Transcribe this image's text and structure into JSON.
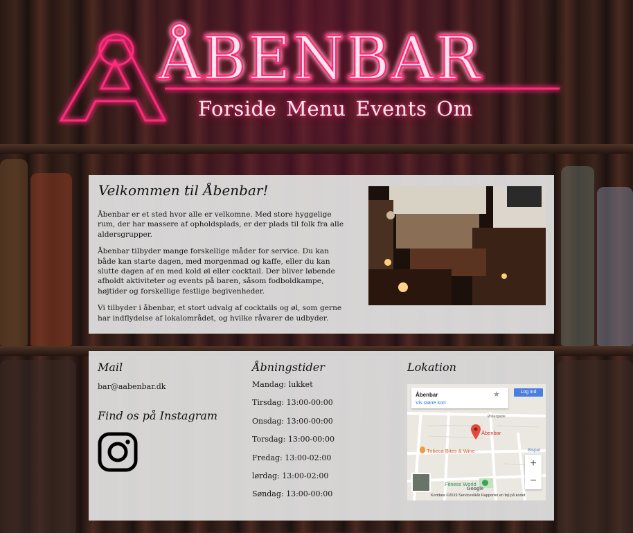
{
  "brand": {
    "name": "ÅBENBAR"
  },
  "nav": {
    "items": [
      "Forside",
      "Menu",
      "Events",
      "Om"
    ]
  },
  "welcome": {
    "title": "Velkommen til Åbenbar!",
    "paragraphs": [
      "Åbenbar er et sted hvor alle er velkomne. Med store hyggelige rum, der har massere af opholdsplads, er der plads til folk fra alle aldersgrupper.",
      "Åbenbar tilbyder mange forskellige måder for service. Du kan både kan starte dagen, med morgenmad og kaffe, eller du kan slutte dagen af en med kold øl eller cocktail. Der bliver løbende afholdt aktiviteter og events på baren, såsom fodboldkampe, højtider og forskellige festlige begivenheder.",
      "Vi tilbyder i åbenbar, et stort udvalg af cocktails og øl, som gerne har indflydelse af lokalområdet, og hvilke råvarer de udbyder."
    ]
  },
  "footer": {
    "mail": {
      "title": "Mail",
      "address": "bar@aabenbar.dk"
    },
    "instagram": {
      "title": "Find os på Instagram",
      "icon": "instagram-icon"
    },
    "hours": {
      "title": "Åbningstider",
      "items": [
        "Mandag: lukket",
        "Tirsdag: 13:00-00:00",
        "Onsdag: 13:00-00:00",
        "Torsdag: 13:00-00:00",
        "Fredag: 13:00-02:00",
        "lørdag: 13:00-02:00",
        "Søndag: 13:00-00:00"
      ]
    },
    "location": {
      "title": "Lokation",
      "map": {
        "place": "Åbenbar",
        "link": "Vis større kort",
        "login": "Log ind",
        "pin_label": "Åbenbar",
        "poi_1": "Tribeca Bites & Wine",
        "poi_2": "Fitness World",
        "street_1": "Østergade",
        "street_2": "Bispet",
        "google": "Google",
        "credits": "Kortdata ©2019   Servicevilkår   Rapporter en fejl på kortet",
        "zoom_in": "+",
        "zoom_out": "−"
      }
    }
  },
  "colors": {
    "neon": "#ff2a7a",
    "panel": "#e2e2e2",
    "map_pin": "#e5473c"
  }
}
